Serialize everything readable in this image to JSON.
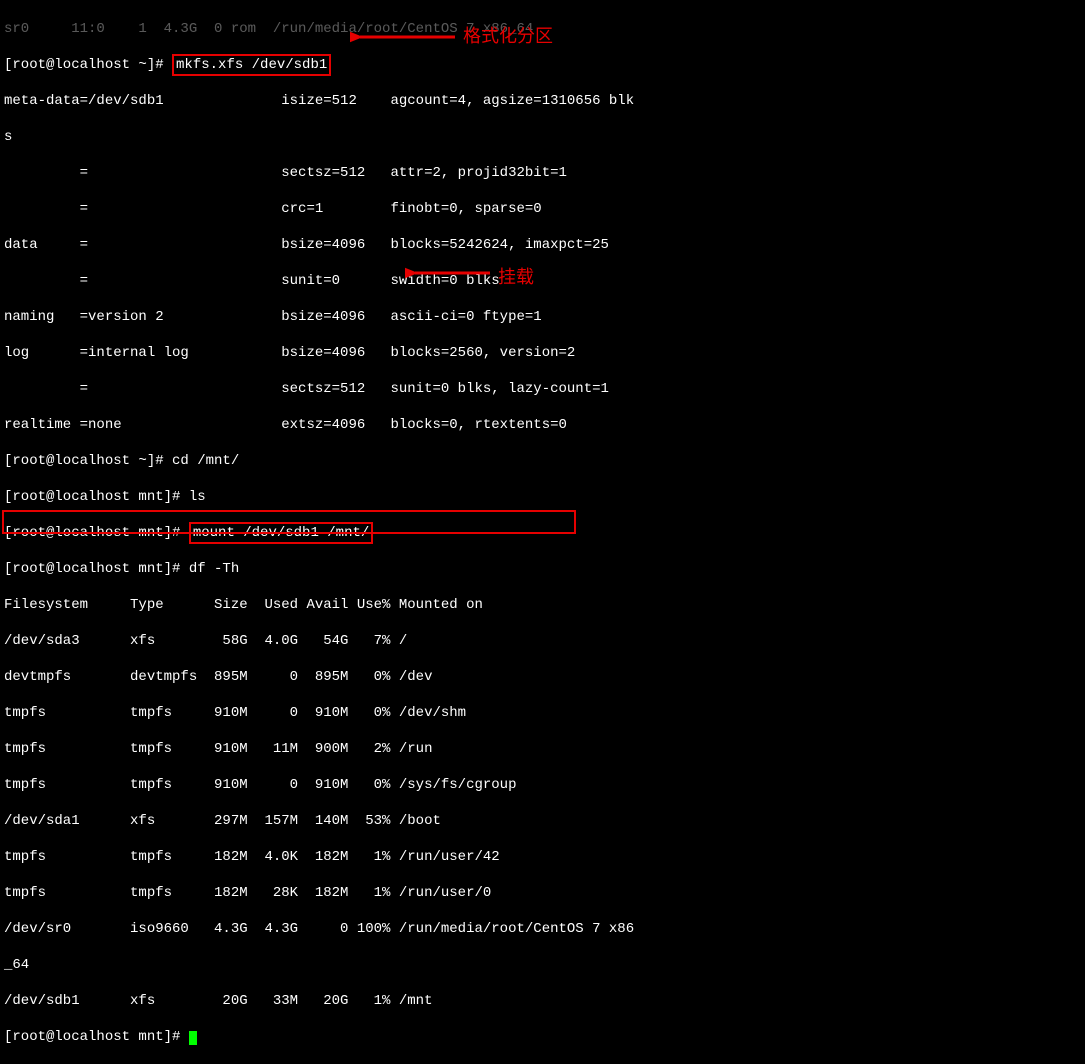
{
  "prompt1_pre": "[root@localhost ~]# ",
  "cmd1": "mkfs.xfs /dev/sdb1",
  "mkfs_out": [
    "meta-data=/dev/sdb1              isize=512    agcount=4, agsize=1310656 blk",
    "s",
    "         =                       sectsz=512   attr=2, projid32bit=1",
    "         =                       crc=1        finobt=0, sparse=0",
    "data     =                       bsize=4096   blocks=5242624, imaxpct=25",
    "         =                       sunit=0      swidth=0 blks",
    "naming   =version 2              bsize=4096   ascii-ci=0 ftype=1",
    "log      =internal log           bsize=4096   blocks=2560, version=2",
    "         =                       sectsz=512   sunit=0 blks, lazy-count=1",
    "realtime =none                   extsz=4096   blocks=0, rtextents=0"
  ],
  "prompts_mid": [
    "[root@localhost ~]# cd /mnt/",
    "[root@localhost mnt]# ls"
  ],
  "prompt_mount_pre": "[root@localhost mnt]# ",
  "cmd_mount": "mount /dev/sdb1 /mnt/",
  "prompt_df": "[root@localhost mnt]# df -Th",
  "df_header": "Filesystem     Type      Size  Used Avail Use% Mounted on",
  "df_rows": [
    "/dev/sda3      xfs        58G  4.0G   54G   7% /",
    "devtmpfs       devtmpfs  895M     0  895M   0% /dev",
    "tmpfs          tmpfs     910M     0  910M   0% /dev/shm",
    "tmpfs          tmpfs     910M   11M  900M   2% /run",
    "tmpfs          tmpfs     910M     0  910M   0% /sys/fs/cgroup",
    "/dev/sda1      xfs       297M  157M  140M  53% /boot",
    "tmpfs          tmpfs     182M  4.0K  182M   1% /run/user/42",
    "tmpfs          tmpfs     182M   28K  182M   1% /run/user/0",
    "/dev/sr0       iso9660   4.3G  4.3G     0 100% /run/media/root/CentOS 7 x86",
    "_64"
  ],
  "df_highlight": "/dev/sdb1      xfs        20G   33M   20G   1% /mnt",
  "prompt_last": "[root@localhost mnt]# ",
  "annotations": {
    "format": "格式化分区",
    "mount": "挂载"
  },
  "top_partial": "sr0     11:0    1  4.3G  0 rom  /run/media/root/CentOS 7 x86_64"
}
